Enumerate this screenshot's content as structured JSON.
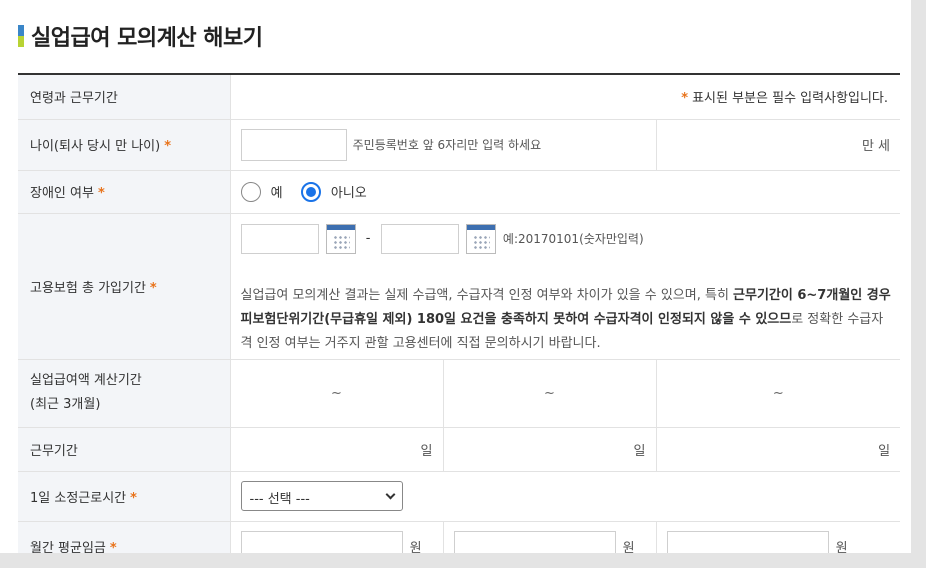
{
  "page": {
    "title": "실업급여 모의계산 해보기"
  },
  "colors": {
    "accent": "#e8731b",
    "radio": "#1a73e8",
    "title_bar_top": "#3a86c8",
    "title_bar_bottom": "#b8d334"
  },
  "header_row": {
    "label": "연령과 근무기간",
    "required_star": "*",
    "required_note": "표시된 부분은 필수 입력사항입니다."
  },
  "age": {
    "label": "나이(퇴사 당시 만 나이)",
    "star": "*",
    "hint": "주민등록번호 앞 6자리만 입력 하세요",
    "unit": "만 세",
    "value": ""
  },
  "disability": {
    "label": "장애인 여부",
    "star": "*",
    "options": [
      "예",
      "아니오"
    ],
    "selected": "아니오"
  },
  "insurance_period": {
    "label": "고용보험 총 가입기간",
    "star": "*",
    "separator": "-",
    "date_hint": "예:20170101(숫자만입력)",
    "note_1": "실업급여 모의계산 결과는 실제 수급액, 수급자격 인정 여부와 차이가 있을 수 있으며, 특히 ",
    "note_b1": "근무기간이 6~7개월인 경우 피보험단위기간(무급휴일 제외) 180일 요건을 충족하지 못하여 수급자격이 인정되지 않을 수 있으므",
    "note_2": "로 정확한 수급자격 인정 여부는 거주지 관할 고용센터에 직접 문의하시기 바랍니다."
  },
  "calc_period": {
    "label_line1": "실업급여액 계산기간",
    "label_line2": "(최근 3개월)",
    "cells": [
      "~",
      "~",
      "~"
    ]
  },
  "work_days": {
    "label": "근무기간",
    "cells": [
      "일",
      "일",
      "일"
    ]
  },
  "daily_hours": {
    "label": "1일 소정근로시간",
    "star": "*",
    "selected": "--- 선택 ---"
  },
  "monthly_wage": {
    "label": "월간 평균임금",
    "star": "*",
    "unit": "원"
  },
  "icons": {
    "calendar": "calendar-icon",
    "chevron": "chevron-down-icon"
  }
}
